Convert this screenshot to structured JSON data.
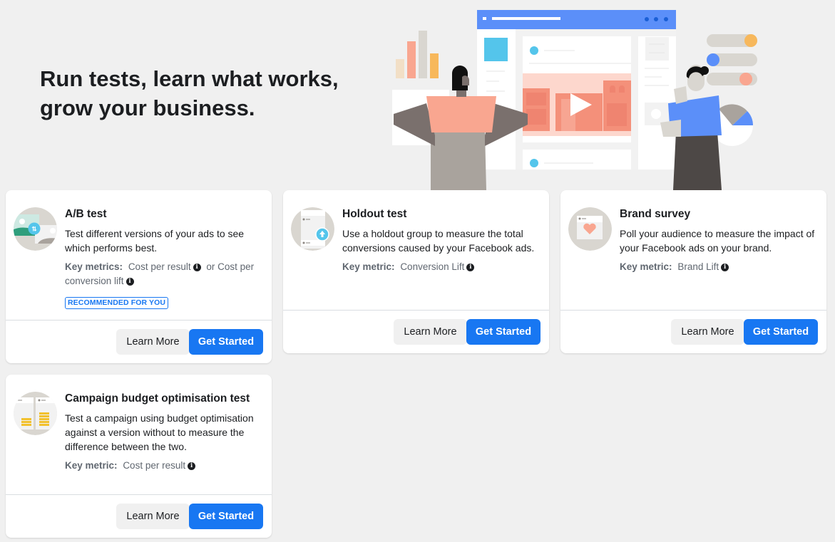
{
  "hero": {
    "title": "Run tests, learn what works, grow your business."
  },
  "colors": {
    "primary": "#1877f2",
    "background": "#f0f0f0",
    "card": "#ffffff",
    "text": "#1c1e21",
    "muted": "#606770"
  },
  "cards": [
    {
      "title": "A/B test",
      "description": "Test different versions of your ads to see which performs best.",
      "metric_label": "Key metrics:",
      "metric_value": "Cost per result",
      "metric_separator": "or Cost per conversion lift",
      "badge": "RECOMMENDED FOR YOU",
      "icon": "ab-test-icon",
      "learn_more": "Learn More",
      "get_started": "Get Started"
    },
    {
      "title": "Holdout test",
      "description": "Use a holdout group to measure the total conversions caused by your Facebook ads.",
      "metric_label": "Key metric:",
      "metric_value": "Conversion Lift",
      "icon": "holdout-test-icon",
      "learn_more": "Learn More",
      "get_started": "Get Started"
    },
    {
      "title": "Brand survey",
      "description": "Poll your audience to measure the impact of your Facebook ads on your brand.",
      "metric_label": "Key metric:",
      "metric_value": "Brand Lift",
      "icon": "brand-survey-icon",
      "learn_more": "Learn More",
      "get_started": "Get Started"
    },
    {
      "title": "Campaign budget optimisation test",
      "description": "Test a campaign using budget optimisation against a version without to measure the difference between the two.",
      "metric_label": "Key metric:",
      "metric_value": "Cost per result",
      "icon": "budget-optimisation-icon",
      "learn_more": "Learn More",
      "get_started": "Get Started"
    }
  ]
}
